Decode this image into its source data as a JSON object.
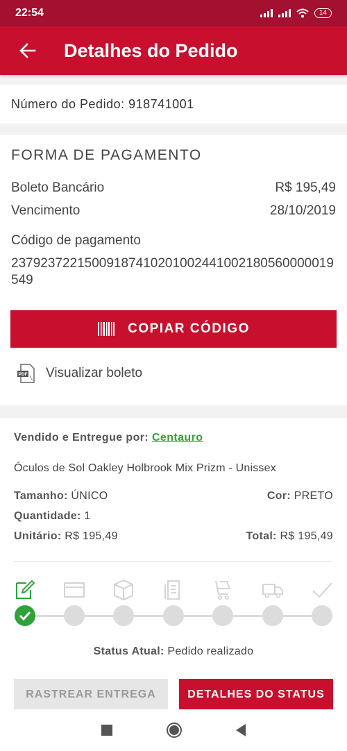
{
  "status_bar": {
    "time": "22:54",
    "battery": "14"
  },
  "header": {
    "title": "Detalhes do Pedido",
    "back_icon": "arrow-left-icon"
  },
  "order": {
    "number_label": "Número do Pedido: 918741001"
  },
  "payment": {
    "section_title": "FORMA DE PAGAMENTO",
    "method_label": "Boleto Bancário",
    "method_value": "R$  195,49",
    "due_label": "Vencimento",
    "due_value": "28/10/2019",
    "code_label": "Código de pagamento",
    "code_value": "23792372215009187410201002441002180560000019549",
    "copy_button": "COPIAR CÓDIGO",
    "view_boleto": "Visualizar boleto"
  },
  "item": {
    "sold_by_label": "Vendido e Entregue por:",
    "seller": "Centauro",
    "product_name": "Óculos de Sol Oakley Holbrook Mix Prizm - Unissex",
    "size_label": "Tamanho:",
    "size_value": "ÚNICO",
    "color_label": "Cor:",
    "color_value": "PRETO",
    "quantity_label": "Quantidade:",
    "quantity_value": "1",
    "unit_label": "Unitário:",
    "unit_value": "R$  195,49",
    "total_label": "Total:",
    "total_value": "R$  195,49"
  },
  "tracking": {
    "steps": [
      "order-placed-icon",
      "card-icon",
      "box-icon",
      "invoice-icon",
      "cart-icon",
      "truck-icon",
      "check-icon"
    ],
    "completed_steps": 1,
    "status_label": "Status Atual:",
    "status_value": "Pedido realizado"
  },
  "actions": {
    "track_button": "RASTREAR ENTREGA",
    "status_button": "DETALHES DO STATUS"
  },
  "colors": {
    "primary": "#c8102e",
    "status_bar": "#a4102f",
    "success": "#2fa23a"
  }
}
